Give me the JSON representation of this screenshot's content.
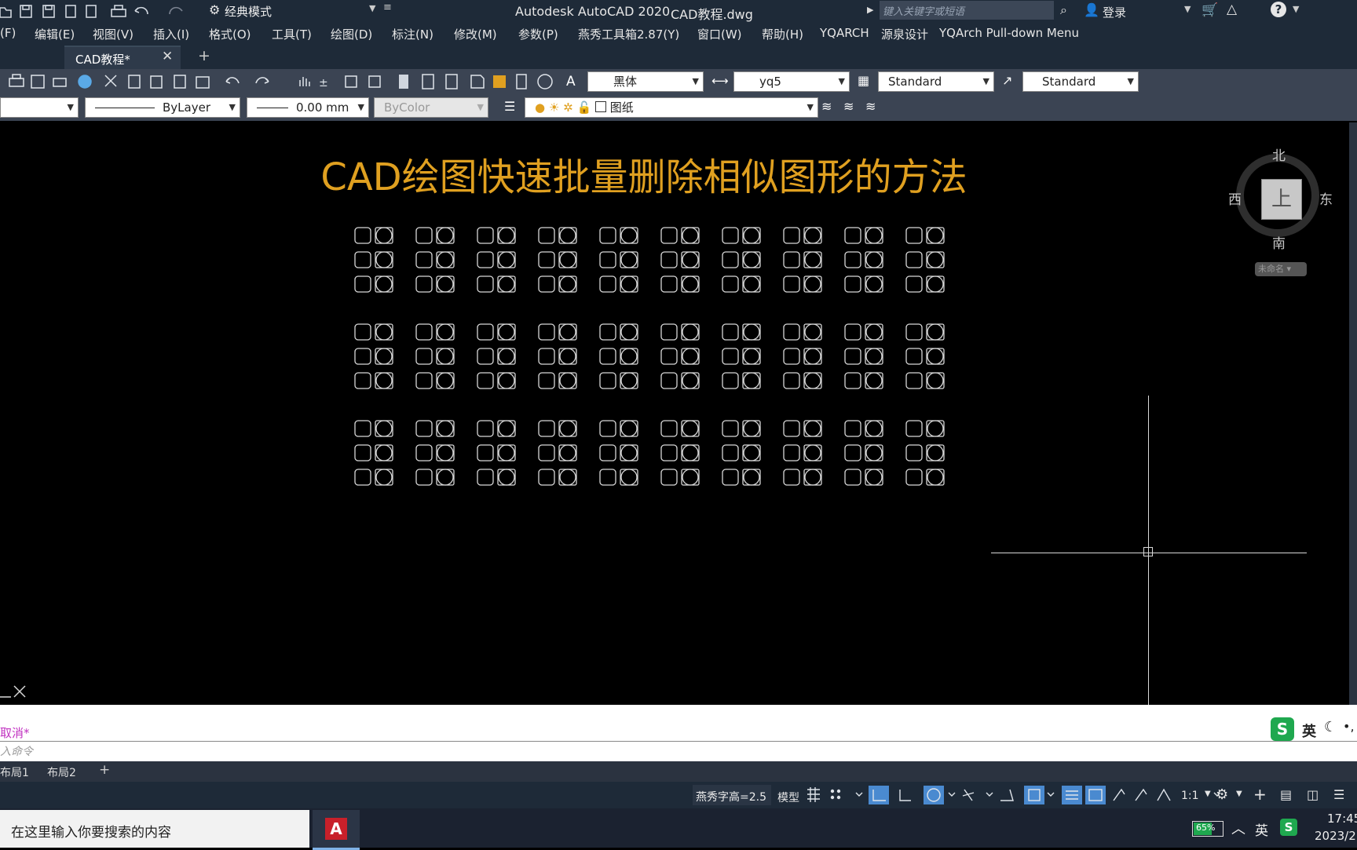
{
  "titlebar": {
    "workspace": "经典模式",
    "app_title": "Autodesk AutoCAD 2020",
    "file_name": "CAD教程.dwg",
    "search_placeholder": "键入关键字或短语",
    "login": "登录"
  },
  "menubar": {
    "items": [
      "(F)",
      "编辑(E)",
      "视图(V)",
      "插入(I)",
      "格式(O)",
      "工具(T)",
      "绘图(D)",
      "标注(N)",
      "修改(M)",
      "参数(P)",
      "燕秀工具箱2.87(Y)",
      "窗口(W)",
      "帮助(H)",
      "YQARCH",
      "源泉设计",
      "YQArch Pull-down Menu"
    ]
  },
  "tabs": {
    "active": "CAD教程*"
  },
  "toolbar1": {
    "font": "黑体",
    "dim_style": "yq5",
    "table_style": "Standard",
    "multileader_style": "Standard"
  },
  "toolbar2": {
    "linetype": "ByLayer",
    "lineweight": "0.00 mm",
    "color": "ByColor",
    "layer": "图纸"
  },
  "canvas": {
    "heading": "CAD绘图快速批量删除相似图形的方法",
    "viewcube": {
      "north": "北",
      "south": "南",
      "east": "东",
      "west": "西",
      "face": "上",
      "wcs": "未命名"
    },
    "colors": {
      "heading": "#e0a020",
      "geometry": "#d8d8d8",
      "background": "#000000"
    }
  },
  "command": {
    "history": "取消*",
    "prompt_placeholder": "入命令",
    "ime_label": "英"
  },
  "layouts": [
    "布局1",
    "布局2"
  ],
  "statusbar": {
    "text_height": "燕秀字高=2.5",
    "model": "模型",
    "scale": "1:1"
  },
  "taskbar": {
    "search_placeholder": "在这里输入你要搜索的内容",
    "battery": "65%",
    "ime": "英",
    "time": "17:45",
    "date": "2023/2"
  }
}
